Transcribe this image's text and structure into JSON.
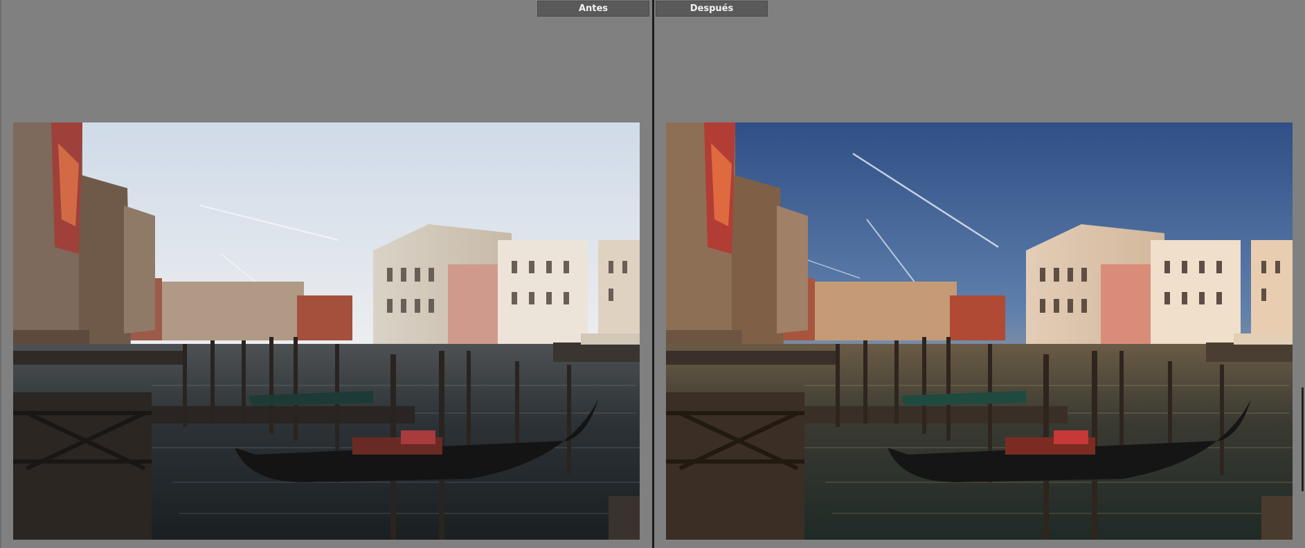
{
  "compare": {
    "before_label": "Antes",
    "after_label": "Después"
  },
  "colors": {
    "background": "#808080",
    "divider": "#1c1c1c",
    "label_bg": "#5a5a5a",
    "label_text": "#f2f2f2"
  }
}
